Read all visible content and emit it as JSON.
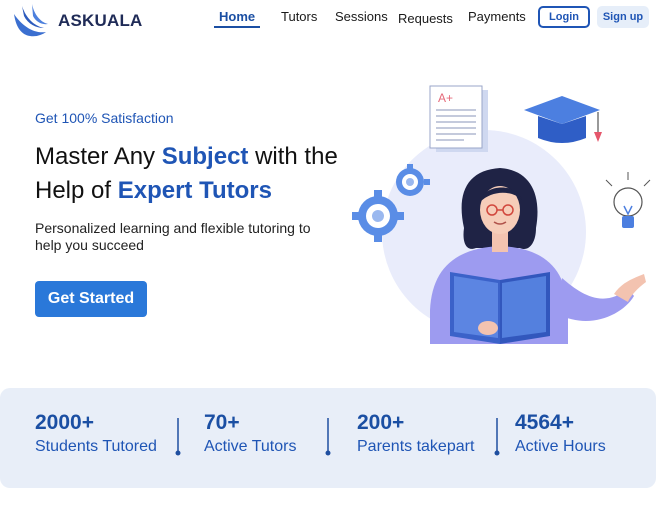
{
  "header": {
    "brand": "ASKUALA",
    "nav": [
      "Home",
      "Tutors",
      "Sessions",
      "Requests",
      "Payments"
    ],
    "login_label": "Login",
    "signup_label": "Sign up"
  },
  "hero": {
    "tagline": "Get 100% Satisfaction",
    "headline_part1": "Master Any ",
    "headline_hl1": "Subject",
    "headline_part2": " with the",
    "headline_part3": "Help of ",
    "headline_hl2": "Expert Tutors",
    "subtext": "Personalized learning and flexible tutoring to help you succeed",
    "cta_label": "Get Started",
    "illustration": {
      "paper_grade": "A+",
      "icons": [
        "graded-paper-icon",
        "graduation-cap-icon",
        "gears-icon",
        "lightbulb-icon"
      ]
    }
  },
  "stats": [
    {
      "value": "2000+",
      "label": "Students Tutored"
    },
    {
      "value": "70+",
      "label": "Active Tutors"
    },
    {
      "value": "200+",
      "label": "Parents takepart"
    },
    {
      "value": "4564+",
      "label": "Active Hours"
    }
  ],
  "colors": {
    "brand_blue": "#1f55b5",
    "nav_active": "#1b4fa3",
    "cta_bg": "#2a78d9",
    "stats_bg": "#e8eef8"
  }
}
